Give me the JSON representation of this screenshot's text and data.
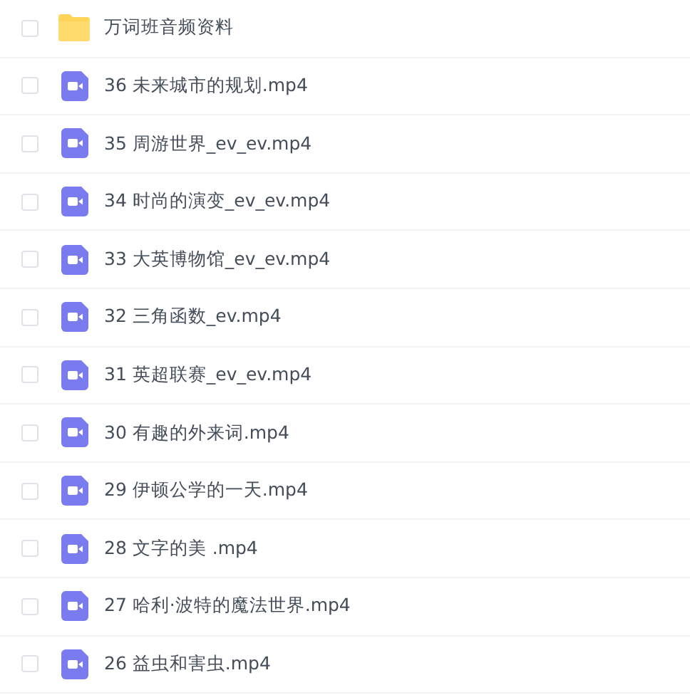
{
  "files": [
    {
      "kind": "folder",
      "name": "万词班音频资料",
      "checked": false
    },
    {
      "kind": "video",
      "name": "36 未来城市的规划.mp4",
      "checked": false
    },
    {
      "kind": "video",
      "name": "35 周游世界_ev_ev.mp4",
      "checked": false
    },
    {
      "kind": "video",
      "name": "34 时尚的演变_ev_ev.mp4",
      "checked": false
    },
    {
      "kind": "video",
      "name": "33 大英博物馆_ev_ev.mp4",
      "checked": false
    },
    {
      "kind": "video",
      "name": "32 三角函数_ev.mp4",
      "checked": false
    },
    {
      "kind": "video",
      "name": "31 英超联赛_ev_ev.mp4",
      "checked": false
    },
    {
      "kind": "video",
      "name": "30 有趣的外来词.mp4",
      "checked": false
    },
    {
      "kind": "video",
      "name": "29 伊顿公学的一天.mp4",
      "checked": false
    },
    {
      "kind": "video",
      "name": "28 文字的美 .mp4",
      "checked": false
    },
    {
      "kind": "video",
      "name": "27 哈利·波特的魔法世界.mp4",
      "checked": false
    },
    {
      "kind": "video",
      "name": "26 益虫和害虫.mp4",
      "checked": false
    }
  ]
}
